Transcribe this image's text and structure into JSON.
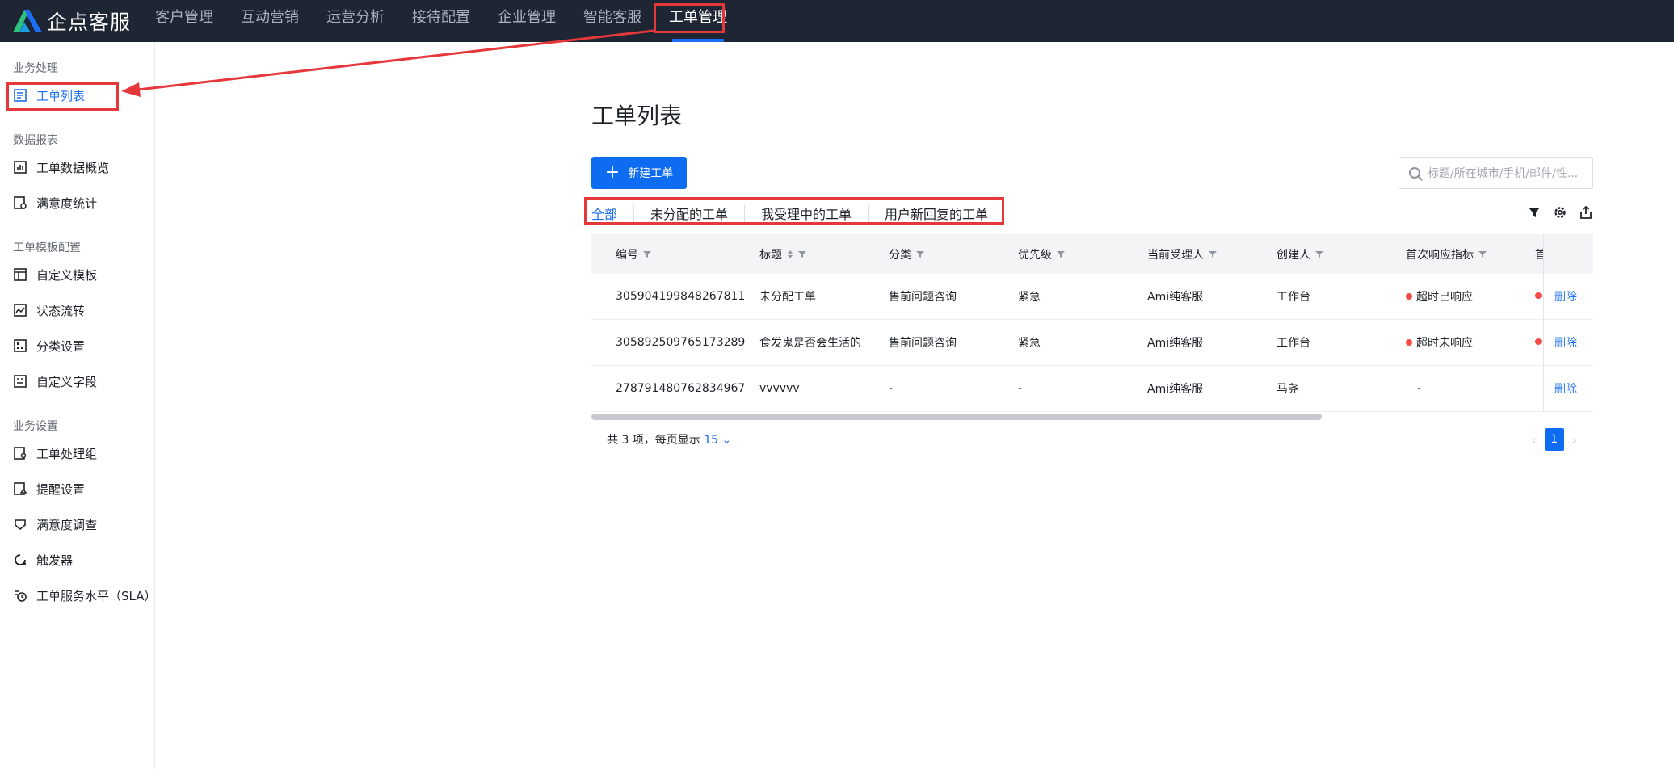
{
  "brand": {
    "name": "企点客服"
  },
  "nav": {
    "items": [
      "客户管理",
      "互动营销",
      "运营分析",
      "接待配置",
      "企业管理",
      "智能客服",
      "工单管理"
    ],
    "active": "工单管理"
  },
  "sidebar": {
    "groups": [
      {
        "title": "业务处理",
        "items": [
          {
            "label": "工单列表",
            "icon": "document-list-icon",
            "active": true
          }
        ]
      },
      {
        "title": "数据报表",
        "items": [
          {
            "label": "工单数据概览",
            "icon": "bar-chart-icon"
          },
          {
            "label": "满意度统计",
            "icon": "gear-report-icon"
          }
        ]
      },
      {
        "title": "工单模板配置",
        "items": [
          {
            "label": "自定义模板",
            "icon": "template-icon"
          },
          {
            "label": "状态流转",
            "icon": "flow-chart-icon"
          },
          {
            "label": "分类设置",
            "icon": "category-icon"
          },
          {
            "label": "自定义字段",
            "icon": "field-icon"
          }
        ]
      },
      {
        "title": "业务设置",
        "items": [
          {
            "label": "工单处理组",
            "icon": "group-icon"
          },
          {
            "label": "提醒设置",
            "icon": "reminder-icon"
          },
          {
            "label": "满意度调查",
            "icon": "survey-icon"
          },
          {
            "label": "触发器",
            "icon": "trigger-icon"
          },
          {
            "label": "工单服务水平（SLA）",
            "icon": "clock-icon"
          }
        ]
      }
    ]
  },
  "main": {
    "title": "工单列表",
    "new_button": "新建工单",
    "search_placeholder": "标题/所在城市/手机/邮件/性...",
    "tabs": [
      "全部",
      "未分配的工单",
      "我受理中的工单",
      "用户新回复的工单"
    ]
  },
  "table": {
    "columns": [
      "编号",
      "标题",
      "分类",
      "优先级",
      "当前受理人",
      "创建人",
      "首次响应指标",
      "首"
    ],
    "rows": [
      {
        "id": "305904199848267811",
        "title": "未分配工单",
        "category": "售前问题咨询",
        "priority": "紧急",
        "assignee": "Ami纯客服",
        "creator": "工作台",
        "first_response": "超时已响应",
        "op": "删除"
      },
      {
        "id": "305892509765173289",
        "title": "食发鬼是否会生活的",
        "category": "售前问题咨询",
        "priority": "紧急",
        "assignee": "Ami纯客服",
        "creator": "工作台",
        "first_response": "超时未响应",
        "op": "删除"
      },
      {
        "id": "278791480762834967",
        "title": "vvvvvv",
        "category": "-",
        "priority": "-",
        "assignee": "Ami纯客服",
        "creator": "马尧",
        "first_response": "-",
        "op": "删除"
      }
    ]
  },
  "footer": {
    "total_text": "共 3 项，每页显示",
    "page_size": "15",
    "current_page": "1"
  },
  "colors": {
    "accent": "#0d6cf2",
    "topbar": "#1f2633",
    "annotation": "#e5383b",
    "status_dot": "#f54a45"
  }
}
